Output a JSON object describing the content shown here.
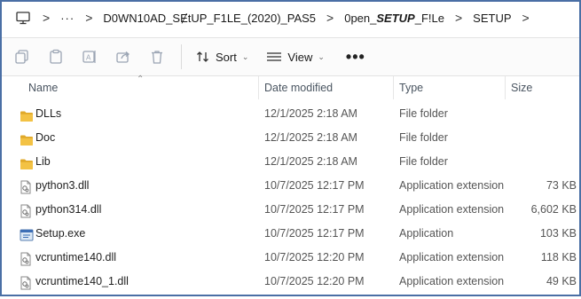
{
  "breadcrumb": {
    "segment1": "D0WN10AD_SɆtUP_F1LE_(2020)_PAS5",
    "segment2_prefix": "0pen_",
    "segment2_bold": "SETUP",
    "segment2_suffix": "_F!Le",
    "segment3": "SETUP",
    "ellipsis": "···",
    "separator": ">"
  },
  "toolbar": {
    "sort_label": "Sort",
    "view_label": "View",
    "more_label": "•••"
  },
  "columns": {
    "name": "Name",
    "date": "Date modified",
    "type": "Type",
    "size": "Size"
  },
  "files": [
    {
      "name": "DLLs",
      "date": "12/1/2025 2:18 AM",
      "type": "File folder",
      "size": "",
      "icon": "folder-icon"
    },
    {
      "name": "Doc",
      "date": "12/1/2025 2:18 AM",
      "type": "File folder",
      "size": "",
      "icon": "folder-icon"
    },
    {
      "name": "Lib",
      "date": "12/1/2025 2:18 AM",
      "type": "File folder",
      "size": "",
      "icon": "folder-icon"
    },
    {
      "name": "python3.dll",
      "date": "10/7/2025 12:17 PM",
      "type": "Application extension",
      "size": "73 KB",
      "icon": "dll-file-icon"
    },
    {
      "name": "python314.dll",
      "date": "10/7/2025 12:17 PM",
      "type": "Application extension",
      "size": "6,602 KB",
      "icon": "dll-file-icon"
    },
    {
      "name": "Setup.exe",
      "date": "10/7/2025 12:17 PM",
      "type": "Application",
      "size": "103 KB",
      "icon": "exe-file-icon"
    },
    {
      "name": "vcruntime140.dll",
      "date": "10/7/2025 12:20 PM",
      "type": "Application extension",
      "size": "118 KB",
      "icon": "dll-file-icon"
    },
    {
      "name": "vcruntime140_1.dll",
      "date": "10/7/2025 12:20 PM",
      "type": "Application extension",
      "size": "49 KB",
      "icon": "dll-file-icon"
    }
  ],
  "colors": {
    "folder": "#f3c244",
    "folder_dark": "#e0a92a",
    "border": "#4a6fa5",
    "disabled_icon": "#9aa4b3"
  }
}
